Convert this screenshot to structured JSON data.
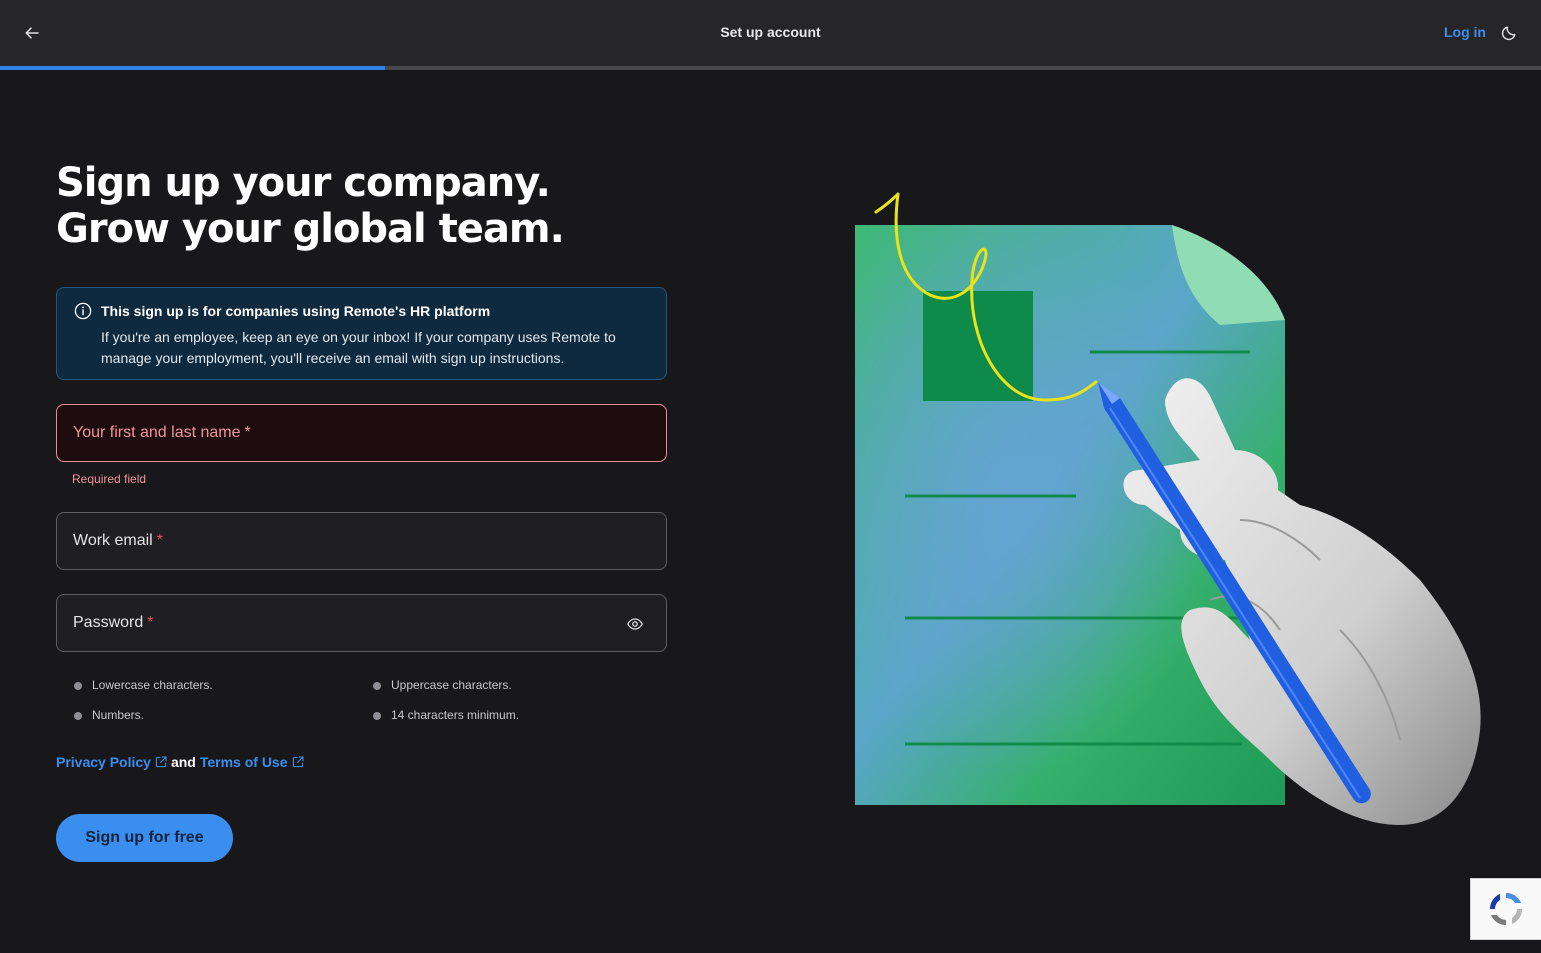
{
  "topbar": {
    "title": "Set up account",
    "login_label": "Log in",
    "back_icon": "arrow-left-icon",
    "theme_icon": "moon-icon"
  },
  "progress": {
    "fraction": 0.25
  },
  "headline": {
    "line1": "Sign up your company.",
    "line2": "Grow your global team."
  },
  "info": {
    "icon": "info-icon",
    "title": "This sign up is for companies using Remote's HR platform",
    "body": "If you're an employee, keep an eye on your inbox! If your company uses Remote to manage your employment, you'll receive an email with sign up instructions."
  },
  "form": {
    "name": {
      "label": "Your first and last name",
      "required_mark": "*",
      "value": "",
      "error": "Required field"
    },
    "email": {
      "label": "Work email",
      "required_mark": "*",
      "value": ""
    },
    "password": {
      "label": "Password",
      "required_mark": "*",
      "value": "",
      "toggle_icon": "eye-icon"
    },
    "rules": [
      "Lowercase characters.",
      "Uppercase characters.",
      "Numbers.",
      "14 characters minimum."
    ]
  },
  "legal": {
    "privacy": "Privacy Policy",
    "and": "and",
    "terms": "Terms of Use",
    "link_icon": "external-link-icon"
  },
  "cta": {
    "label": "Sign up for free"
  },
  "colors": {
    "accent": "#3a8ef0",
    "error": "#f0929c",
    "background": "#18181a",
    "document_green": "#2fae6a",
    "pen_blue": "#1f5fe0",
    "squiggle_yellow": "#e9e31a"
  }
}
